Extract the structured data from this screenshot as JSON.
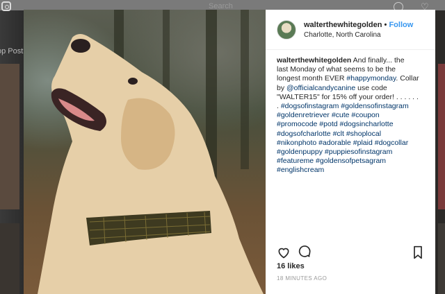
{
  "background": {
    "search_placeholder": "Search",
    "side_label": "op Post"
  },
  "post": {
    "username": "walterthewhitegolden",
    "separator": "•",
    "follow_label": "Follow",
    "location": "Charlotte, North Carolina",
    "caption": {
      "lines": [
        [
          {
            "t": "u",
            "v": "walterthewhitegolden"
          },
          {
            "t": "x",
            "v": " And finally... the"
          }
        ],
        [
          {
            "t": "x",
            "v": "last Monday of what seems to be the"
          }
        ],
        [
          {
            "t": "x",
            "v": "longest month EVER "
          },
          {
            "t": "h",
            "v": "#happymonday"
          },
          {
            "t": "x",
            "v": ". Collar"
          }
        ],
        [
          {
            "t": "x",
            "v": "by "
          },
          {
            "t": "h",
            "v": "@officialcandycanine"
          },
          {
            "t": "x",
            "v": " use code"
          }
        ],
        [
          {
            "t": "x",
            "v": "\"WALTER15\" for 15% off your order! . . . . . ."
          }
        ],
        [
          {
            "t": "x",
            "v": ". "
          },
          {
            "t": "h",
            "v": "#dogsofinstagram"
          },
          {
            "t": "x",
            "v": " "
          },
          {
            "t": "h",
            "v": "#goldensofinstagram"
          }
        ],
        [
          {
            "t": "h",
            "v": "#goldenretriever"
          },
          {
            "t": "x",
            "v": " "
          },
          {
            "t": "h",
            "v": "#cute"
          },
          {
            "t": "x",
            "v": " "
          },
          {
            "t": "h",
            "v": "#coupon"
          }
        ],
        [
          {
            "t": "h",
            "v": "#promocode"
          },
          {
            "t": "x",
            "v": " "
          },
          {
            "t": "h",
            "v": "#potd"
          },
          {
            "t": "x",
            "v": " "
          },
          {
            "t": "h",
            "v": "#dogsincharlotte"
          }
        ],
        [
          {
            "t": "h",
            "v": "#dogsofcharlotte"
          },
          {
            "t": "x",
            "v": " "
          },
          {
            "t": "h",
            "v": "#clt"
          },
          {
            "t": "x",
            "v": " "
          },
          {
            "t": "h",
            "v": "#shoplocal"
          }
        ],
        [
          {
            "t": "h",
            "v": "#nikonphoto"
          },
          {
            "t": "x",
            "v": " "
          },
          {
            "t": "h",
            "v": "#adorable"
          },
          {
            "t": "x",
            "v": " "
          },
          {
            "t": "h",
            "v": "#plaid"
          },
          {
            "t": "x",
            "v": " "
          },
          {
            "t": "h",
            "v": "#dogcollar"
          }
        ],
        [
          {
            "t": "h",
            "v": "#goldenpuppy"
          },
          {
            "t": "x",
            "v": " "
          },
          {
            "t": "h",
            "v": "#puppiesofinstagram"
          }
        ],
        [
          {
            "t": "h",
            "v": "#featureme"
          },
          {
            "t": "x",
            "v": " "
          },
          {
            "t": "h",
            "v": "#goldensofpetsagram"
          }
        ],
        [
          {
            "t": "h",
            "v": "#englishcream"
          }
        ]
      ]
    },
    "likes": "16 likes",
    "timestamp": "18 MINUTES AGO",
    "icons": [
      "heart-icon",
      "comment-icon",
      "bookmark-icon"
    ],
    "colors": {
      "link": "#003569",
      "follow": "#3897f0",
      "muted": "#999999"
    }
  }
}
